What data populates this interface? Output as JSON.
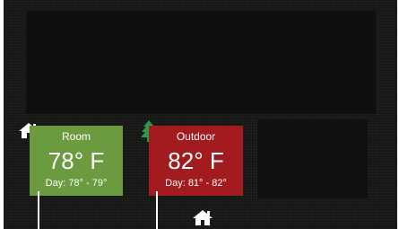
{
  "tiles": {
    "room": {
      "title": "Room",
      "temperature": "78° F",
      "day_range": "Day: 78° - 79°",
      "color": "#6c9a3e",
      "icon": "home-icon"
    },
    "outdoor": {
      "title": "Outdoor",
      "temperature": "82° F",
      "day_range": "Day: 81° - 82°",
      "color": "#a21c1f",
      "icon": "tree-icon"
    }
  },
  "bottom_icon": "home-icon",
  "colors": {
    "background": "#161816",
    "panel": "#0f0f0f",
    "tree": "#2e9a45",
    "icon": "#ffffff"
  }
}
